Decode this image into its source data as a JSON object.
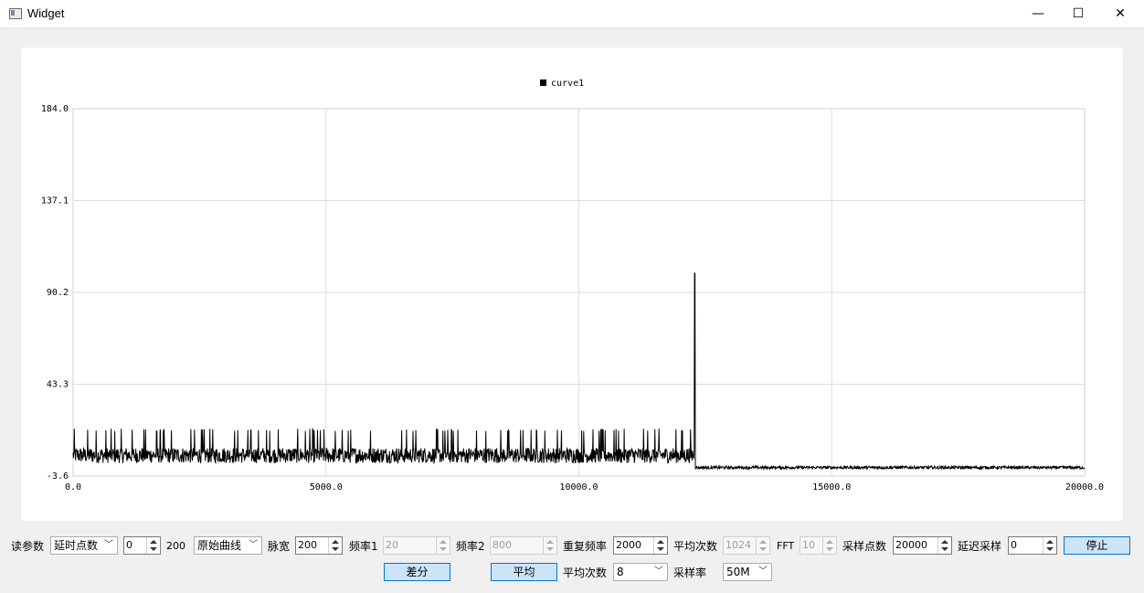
{
  "window": {
    "title": "Widget",
    "minimize": "—",
    "maximize": "☐",
    "close": "✕"
  },
  "chart_data": {
    "type": "line",
    "legend": [
      "curve1"
    ],
    "series": [
      {
        "name": "curve1",
        "description_values": {
          "noise_band_left": [
            0,
            12300,
            3,
            14
          ],
          "spike_x": 12290,
          "spike_y": 100,
          "noise_band_right": [
            12300,
            20000,
            0,
            1.5
          ]
        }
      }
    ],
    "xlim": [
      0.0,
      20000.0
    ],
    "ylim": [
      -3.6,
      184.0
    ],
    "xticks": [
      "0.0",
      "5000.0",
      "10000.0",
      "15000.0",
      "20000.0"
    ],
    "yticks": [
      "184.0",
      "137.1",
      "90.2",
      "43.3",
      "-3.6"
    ],
    "grid": true,
    "legend_position": "top-center"
  },
  "controls": {
    "read_params_label": "读参数",
    "delay_points_combo": "延时点数",
    "delay_spin": "0",
    "value_200": "200",
    "raw_curve_combo": "原始曲线",
    "pulse_width_label": "脉宽",
    "pulse_width_spin": "200",
    "freq1_label": "频率1",
    "freq1_spin": "20",
    "freq2_label": "频率2",
    "freq2_spin": "800",
    "rep_freq_label": "重复频率",
    "rep_freq_spin": "2000",
    "avg_count_label": "平均次数",
    "avg_count_spin": "1024",
    "fft_label": "FFT",
    "fft_spin": "10",
    "sample_points_label": "采样点数",
    "sample_points_spin": "20000",
    "delay_sample_label": "延迟采样",
    "delay_sample_spin": "0",
    "stop_button": "停止",
    "diff_button": "差分",
    "avg_button": "平均",
    "avg_count2_label": "平均次数",
    "avg_count2_combo": "8",
    "sample_rate_label": "采样率",
    "sample_rate_combo": "50M"
  }
}
